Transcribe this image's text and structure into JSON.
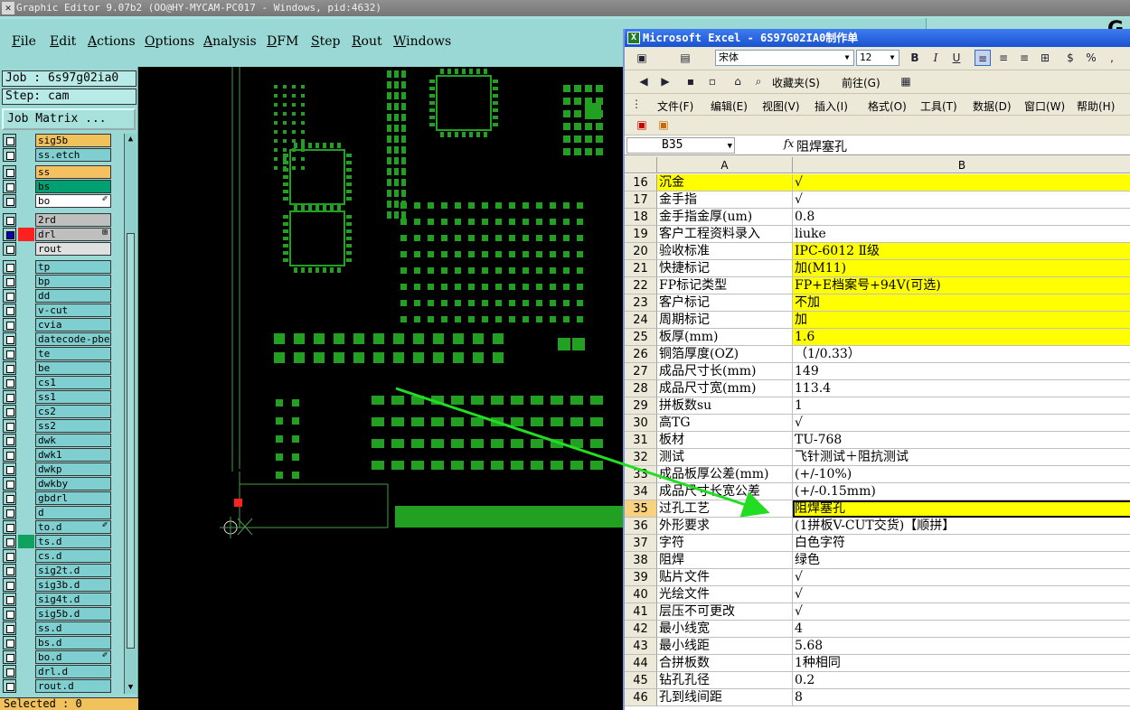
{
  "genesis": {
    "title": "Graphic Editor 9.07b2  (OO@HY-MYCAM-PC017 - Windows, pid:4632)",
    "menu": [
      "File",
      "Edit",
      "Actions",
      "Options",
      "Analysis",
      "DFM",
      "Step",
      "Rout",
      "Windows"
    ],
    "right_panel_letter": "G",
    "job_label": "Job : 6s97g02ia0",
    "step_label": "Step: cam",
    "job_matrix_button": "Job Matrix ...",
    "selected_label": "Selected : 0",
    "layers": [
      {
        "name": "sig5b",
        "color": "#f1c15c",
        "check": "empty"
      },
      {
        "name": "ss.etch",
        "color": "#7fcfd0",
        "check": "empty"
      },
      {
        "name": "ss",
        "color": "#f5c060",
        "check": "empty"
      },
      {
        "name": "bs",
        "color": "#00a070",
        "check": "empty"
      },
      {
        "name": "bo",
        "color": "#ffffff",
        "check": "empty",
        "mark": "✐"
      },
      {
        "name": "2rd",
        "color": "#bfbfbf",
        "check": "empty"
      },
      {
        "name": "drl",
        "color": "#bfbfbf",
        "check": "blue",
        "swatch": "#ff2020",
        "mark": "⊞"
      },
      {
        "name": "rout",
        "color": "#e0e0e0",
        "check": "empty"
      },
      {
        "name": "tp",
        "color": "#7fcfd0",
        "check": "empty"
      },
      {
        "name": "bp",
        "color": "#7fcfd0",
        "check": "empty"
      },
      {
        "name": "dd",
        "color": "#7fcfd0",
        "check": "empty"
      },
      {
        "name": "v-cut",
        "color": "#7fcfd0",
        "check": "empty"
      },
      {
        "name": "cvia",
        "color": "#7fcfd0",
        "check": "empty"
      },
      {
        "name": "datecode-pbe",
        "color": "#7fcfd0",
        "check": "empty"
      },
      {
        "name": "te",
        "color": "#7fcfd0",
        "check": "empty"
      },
      {
        "name": "be",
        "color": "#7fcfd0",
        "check": "empty"
      },
      {
        "name": "cs1",
        "color": "#7fcfd0",
        "check": "empty"
      },
      {
        "name": "ss1",
        "color": "#7fcfd0",
        "check": "empty"
      },
      {
        "name": "cs2",
        "color": "#7fcfd0",
        "check": "empty"
      },
      {
        "name": "ss2",
        "color": "#7fcfd0",
        "check": "empty"
      },
      {
        "name": "dwk",
        "color": "#7fcfd0",
        "check": "empty"
      },
      {
        "name": "dwk1",
        "color": "#7fcfd0",
        "check": "empty"
      },
      {
        "name": "dwkp",
        "color": "#7fcfd0",
        "check": "empty"
      },
      {
        "name": "dwkby",
        "color": "#7fcfd0",
        "check": "empty"
      },
      {
        "name": "gbdrl",
        "color": "#7fcfd0",
        "check": "empty"
      },
      {
        "name": "d",
        "color": "#7fcfd0",
        "check": "empty"
      },
      {
        "name": "to.d",
        "color": "#7fcfd0",
        "check": "empty",
        "mark": "✐"
      },
      {
        "name": "ts.d",
        "color": "#7fcfd0",
        "check": "empty",
        "swatch": "#10a060"
      },
      {
        "name": "cs.d",
        "color": "#7fcfd0",
        "check": "empty"
      },
      {
        "name": "sig2t.d",
        "color": "#7fcfd0",
        "check": "empty"
      },
      {
        "name": "sig3b.d",
        "color": "#7fcfd0",
        "check": "empty"
      },
      {
        "name": "sig4t.d",
        "color": "#7fcfd0",
        "check": "empty"
      },
      {
        "name": "sig5b.d",
        "color": "#7fcfd0",
        "check": "empty"
      },
      {
        "name": "ss.d",
        "color": "#7fcfd0",
        "check": "empty"
      },
      {
        "name": "bs.d",
        "color": "#7fcfd0",
        "check": "empty"
      },
      {
        "name": "bo.d",
        "color": "#7fcfd0",
        "check": "empty",
        "mark": "✐"
      },
      {
        "name": "drl.d",
        "color": "#7fcfd0",
        "check": "empty"
      },
      {
        "name": "rout.d",
        "color": "#7fcfd0",
        "check": "empty"
      }
    ]
  },
  "excel": {
    "title": "Microsoft Excel - 6S97G02IA0制作单",
    "font_name": "宋体",
    "font_size": "12",
    "favorites": "收藏夹(S)",
    "goto": "前往(G)",
    "menu": [
      "文件(F)",
      "编辑(E)",
      "视图(V)",
      "插入(I)",
      "格式(O)",
      "工具(T)",
      "数据(D)",
      "窗口(W)",
      "帮助(H)"
    ],
    "name_box": "B35",
    "fx": "fx",
    "formula_value": "阻焊塞孔",
    "col_a": "A",
    "col_b": "B",
    "rows": [
      {
        "n": "16",
        "a": "沉金",
        "b": "√",
        "ya": true,
        "yb": true
      },
      {
        "n": "17",
        "a": "金手指",
        "b": "√"
      },
      {
        "n": "18",
        "a": "金手指金厚(um)",
        "b": "0.8"
      },
      {
        "n": "19",
        "a": "客户工程资料录入",
        "b": "liuke"
      },
      {
        "n": "20",
        "a": "验收标准",
        "b": "IPC-6012 Ⅱ级",
        "yb": true
      },
      {
        "n": "21",
        "a": "快捷标记",
        "b": "加(M11)",
        "yb": true
      },
      {
        "n": "22",
        "a": "FP标记类型",
        "b": "FP+E档案号+94V(可选)",
        "yb": true
      },
      {
        "n": "23",
        "a": "客户标记",
        "b": "不加",
        "yb": true
      },
      {
        "n": "24",
        "a": "周期标记",
        "b": "加",
        "yb": true
      },
      {
        "n": "25",
        "a": "板厚(mm)",
        "b": "1.6",
        "yb": true
      },
      {
        "n": "26",
        "a": "铜箔厚度(OZ)",
        "b": "（1/0.33）"
      },
      {
        "n": "27",
        "a": "成品尺寸长(mm)",
        "b": "149"
      },
      {
        "n": "28",
        "a": "成品尺寸宽(mm)",
        "b": "113.4"
      },
      {
        "n": "29",
        "a": "拼板数su",
        "b": "1"
      },
      {
        "n": "30",
        "a": "高TG",
        "b": "√"
      },
      {
        "n": "31",
        "a": "板材",
        "b": "TU-768"
      },
      {
        "n": "32",
        "a": "测试",
        "b": "飞针测试＋阻抗测试"
      },
      {
        "n": "33",
        "a": "成品板厚公差(mm)",
        "b": "(+/-10%)"
      },
      {
        "n": "34",
        "a": "成品尺寸长宽公差",
        "b": "(+/-0.15mm)"
      },
      {
        "n": "35",
        "a": "过孔工艺",
        "b": "阻焊塞孔",
        "yb": true,
        "active": true
      },
      {
        "n": "36",
        "a": "外形要求",
        "b": "(1拼板V-CUT交货)【顺拼】"
      },
      {
        "n": "37",
        "a": "字符",
        "b": "白色字符"
      },
      {
        "n": "38",
        "a": "阻焊",
        "b": "绿色"
      },
      {
        "n": "39",
        "a": "贴片文件",
        "b": "√"
      },
      {
        "n": "40",
        "a": "光绘文件",
        "b": "√"
      },
      {
        "n": "41",
        "a": "层压不可更改",
        "b": "√"
      },
      {
        "n": "42",
        "a": "最小线宽",
        "b": "4"
      },
      {
        "n": "43",
        "a": "最小线距",
        "b": "5.68"
      },
      {
        "n": "44",
        "a": "合拼板数",
        "b": "1种相同"
      },
      {
        "n": "45",
        "a": "钻孔孔径",
        "b": "0.2"
      },
      {
        "n": "46",
        "a": "孔到线间距",
        "b": "8"
      }
    ]
  },
  "colors": {
    "genesis_bg": "#99d8d4",
    "pcb_pad": "#22a022",
    "annotation_arrow": "#22dd22",
    "excel_highlight": "#ffff00"
  }
}
